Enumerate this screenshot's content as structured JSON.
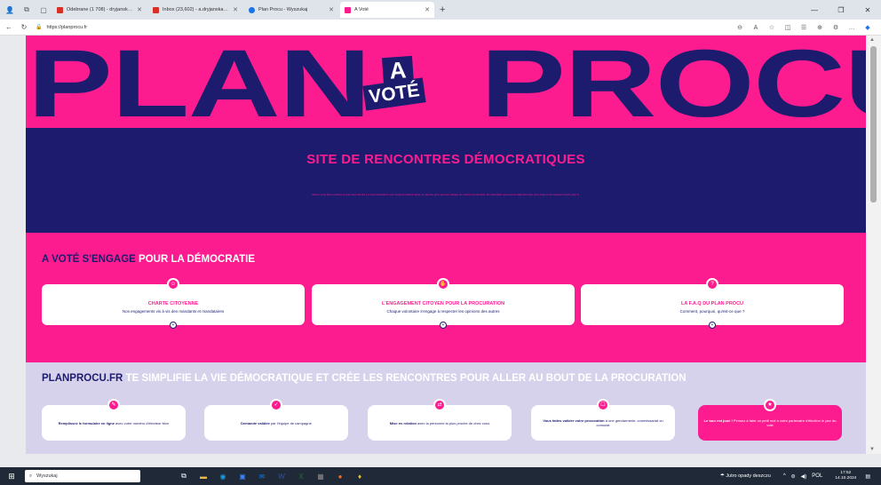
{
  "tabs": [
    {
      "label": "Odebrane (1 708) - dryjanska.ul...",
      "icon": "gmail-icon",
      "color": "#d93025"
    },
    {
      "label": "Inbox (23,602) - a.dryjanska@uw...",
      "icon": "gmail-icon",
      "color": "#d93025"
    },
    {
      "label": "Plan Procu - Wyszukaj",
      "icon": "search-icon",
      "color": "#1a73e8"
    },
    {
      "label": "A Voté",
      "icon": "avote-icon",
      "color": "#fd1c8f"
    }
  ],
  "address": {
    "url": "https://planprocu.fr"
  },
  "hero": {
    "left": "PLAN",
    "right": "PROCU",
    "badge_a": "A",
    "badge_vote": "VOTÉ"
  },
  "banner": {
    "title": "SITE DE RENCONTRES DÉMOCRATIQUES",
    "body": "Même sous des nombres et sous des lois du 1 er les inscriptions sont toujours étaient mises en attente pour que les chaque un votant et ensemble. En attendant nous avons déjà fait cette pour cette et les espace besoin pour fr."
  },
  "engage": {
    "title_part1": "A VOTÉ S'ENGAGE",
    "title_part2": "POUR LA DÉMOCRATIE",
    "cards": [
      {
        "title": "CHARTE CITOYENNE",
        "subtitle": "Nos engagements vis à vis des mandants et mandataires"
      },
      {
        "title": "L'ENGAGEMENT CITOYEN POUR LA PROCURATION",
        "subtitle": "Chaque volontaire s'engage à respecter les opinions des autres"
      },
      {
        "title": "LA F.A.Q DU PLAN PROCU",
        "subtitle": "Comment, pourquoi, qu'est-ce que ?"
      }
    ]
  },
  "simplifie": {
    "title_part1": "PLANPROCU.FR",
    "title_part2": "TE SIMPLIFIE LA VIE DÉMOCRATIQUE ET CRÉE LES RENCONTRES POUR ALLER AU BOUT DE LA PROCURATION",
    "steps": [
      {
        "bold": "Remplissez le formulaire en ligne",
        "text": " avec votre numéro d'électeur·trice"
      },
      {
        "bold": "Demande validée",
        "text": " par l'équipe de campagne"
      },
      {
        "bold": "Mise en relation",
        "text": " avec la personne la plus proche de chez vous"
      },
      {
        "bold": "Vous faites valider votre procuration",
        "text": " à une gendarmerie, commissariat ou consulat"
      },
      {
        "bold": "Le tour est joué !",
        "text": " Pensez à faire un petit mot à votre partenaire d'élection le jour du vote"
      }
    ]
  },
  "taskbar": {
    "search_placeholder": "Wyszukaj",
    "weather": "Jutro opady deszczu",
    "lang": "POL",
    "time": "17:52",
    "date": "14.10.2024"
  },
  "colors": {
    "pink": "#fd1c8f",
    "navy": "#1d1b6e",
    "lavender": "#d7d2ec"
  }
}
